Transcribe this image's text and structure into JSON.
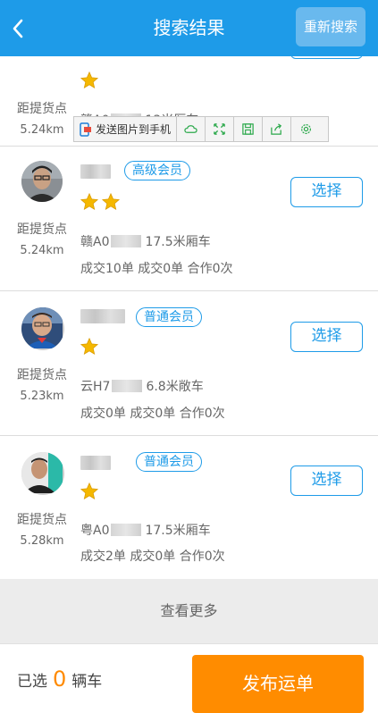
{
  "header": {
    "title": "搜索结果",
    "research_label": "重新搜索"
  },
  "toolbar": {
    "send_label": "发送图片到手机",
    "icons": [
      "cloud-icon",
      "expand-icon",
      "save-icon",
      "share-icon",
      "settings-icon"
    ]
  },
  "cards": [
    {
      "dist_label": "距提货点",
      "dist_value": "5.24km",
      "plate_prefix": "赣A0",
      "truck": "13米厢车",
      "stars": 1
    },
    {
      "dist_label": "距提货点",
      "dist_value": "5.24km",
      "badge": "高级会员",
      "stars": 2,
      "plate_prefix": "赣A0",
      "truck": "17.5米厢车",
      "stats": "成交10单  成交0单  合作0次",
      "select_label": "选择"
    },
    {
      "dist_label": "距提货点",
      "dist_value": "5.23km",
      "badge": "普通会员",
      "stars": 1,
      "plate_prefix": "云H7",
      "truck": "6.8米敞车",
      "stats": "成交0单  成交0单  合作0次",
      "select_label": "选择"
    },
    {
      "dist_label": "距提货点",
      "dist_value": "5.28km",
      "badge": "普通会员",
      "stars": 1,
      "plate_prefix": "粤A0",
      "truck": "17.5米厢车",
      "stats": "成交2单  成交0单  合作0次",
      "select_label": "选择"
    }
  ],
  "more_label": "查看更多",
  "bottom": {
    "selected_prefix": "已选",
    "selected_count": "0",
    "selected_suffix": "辆车",
    "publish_label": "发布运单"
  },
  "colors": {
    "primary": "#1e9be8",
    "accent": "#ff8c00",
    "star": "#f5b800"
  }
}
